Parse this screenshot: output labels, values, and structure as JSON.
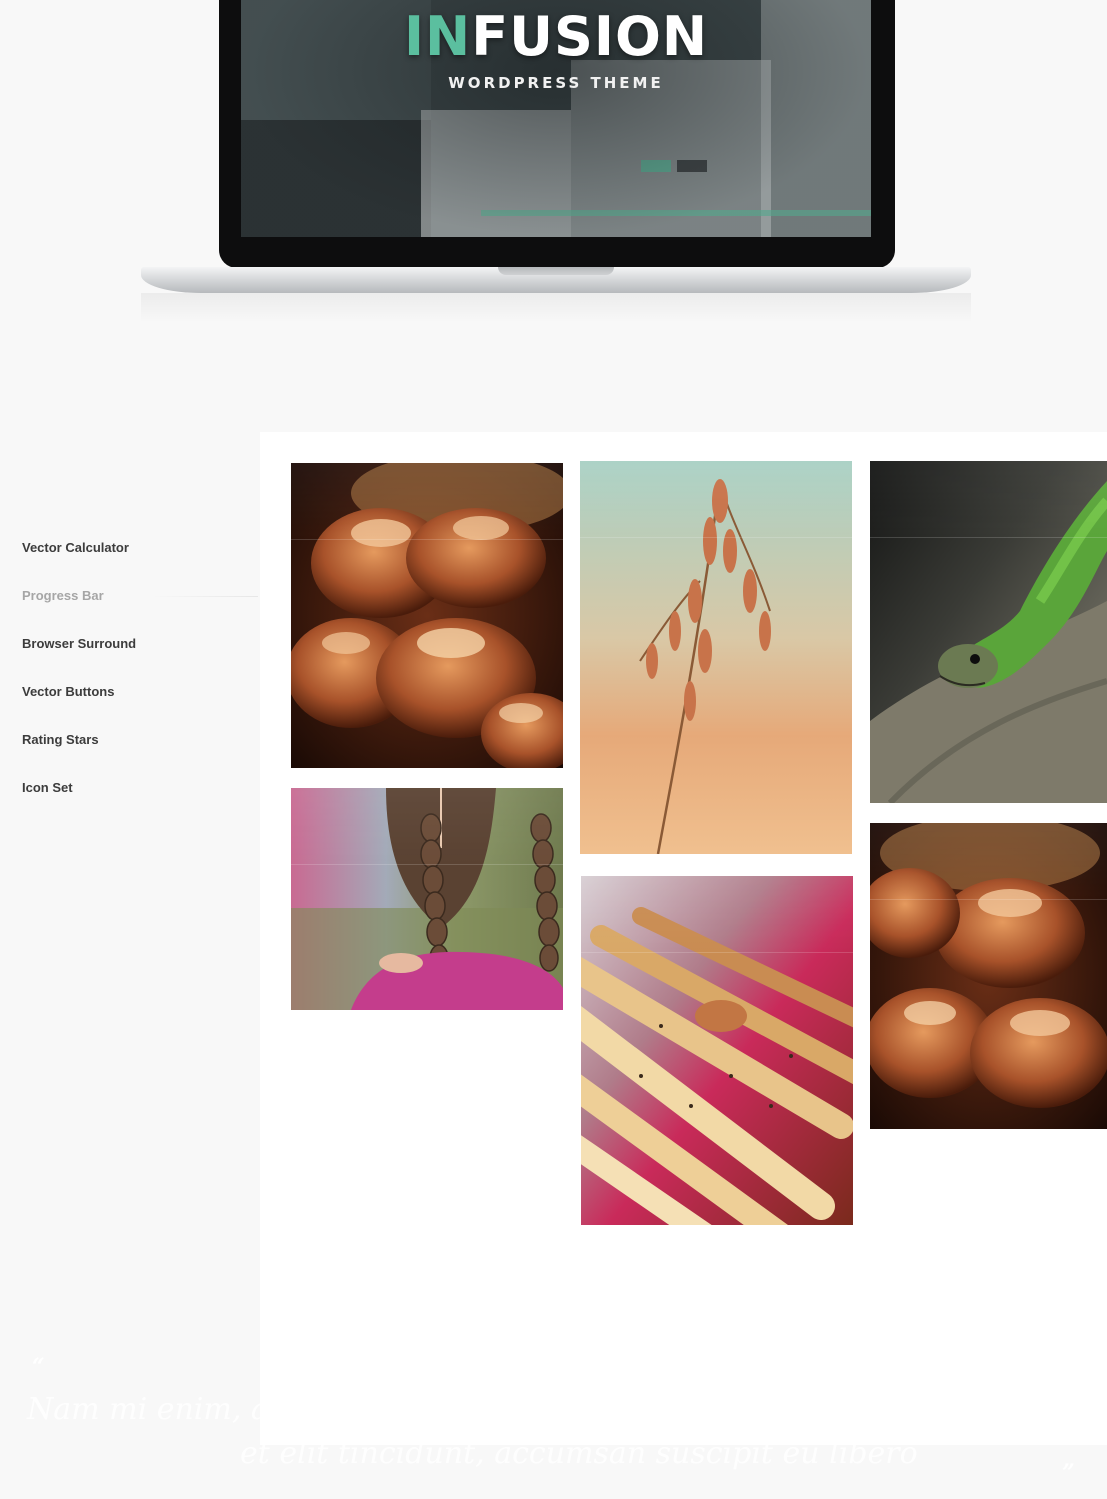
{
  "hero": {
    "title_accent": "IN",
    "title_rest": "FUSION",
    "subtitle": "WORDPRESS THEME"
  },
  "sidebar": {
    "items": [
      {
        "label": "Vector Calculator",
        "state": "default"
      },
      {
        "label": "Progress Bar",
        "state": "muted"
      },
      {
        "label": "Browser Surround",
        "state": "default"
      },
      {
        "label": "Vector Buttons",
        "state": "default"
      },
      {
        "label": "Rating Stars",
        "state": "default"
      },
      {
        "label": "Icon Set",
        "state": "default"
      }
    ]
  },
  "gallery": {
    "photos": [
      {
        "subject": "pastry-cookies"
      },
      {
        "subject": "wheat-grass"
      },
      {
        "subject": "green-lizard"
      },
      {
        "subject": "braided-hair-girl"
      },
      {
        "subject": "bread-sticks"
      },
      {
        "subject": "pastry-cookies"
      }
    ]
  },
  "quote": {
    "open_mark": "“",
    "line1": "Nam mi enim, a",
    "line2": "et elit tincidunt, accumsan suscipit eu libero",
    "close_mark": "”"
  },
  "colors": {
    "accent": "#5bbf9f",
    "page_bg": "#f8f8f8",
    "nav_text": "#3c3c3c",
    "nav_muted": "#a6a6a6"
  }
}
